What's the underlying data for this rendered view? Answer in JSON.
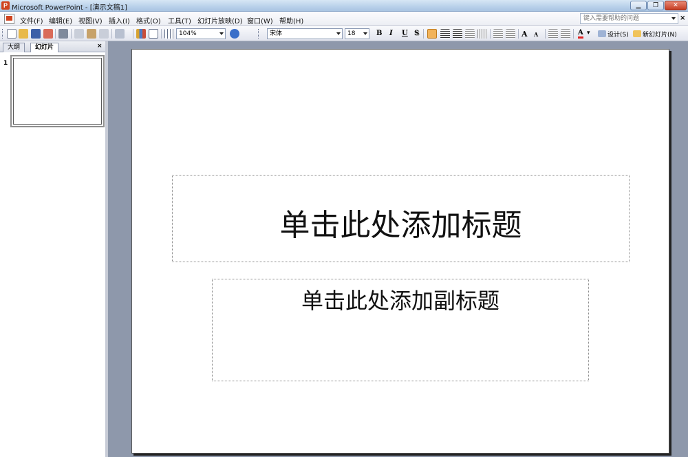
{
  "window": {
    "title": "Microsoft PowerPoint - [演示文稿1]",
    "app_icon_letter": "P"
  },
  "menu": {
    "items": [
      "文件(F)",
      "编辑(E)",
      "视图(V)",
      "插入(I)",
      "格式(O)",
      "工具(T)",
      "幻灯片放映(D)",
      "窗口(W)",
      "帮助(H)"
    ],
    "help_placeholder": "键入需要帮助的问题",
    "close_symbol": "×"
  },
  "toolbar": {
    "zoom": "104%",
    "font_name": "宋体",
    "font_size": "18",
    "bold": "B",
    "italic": "I",
    "underline": "U",
    "shadow": "S",
    "grow_font": "A",
    "shrink_font": "A",
    "font_color": "A",
    "design_label": "设计(S)",
    "new_slide_label": "新幻灯片(N)"
  },
  "left_pane": {
    "tabs": [
      "大纲",
      "幻灯片"
    ],
    "active_tab": "幻灯片",
    "close_symbol": "×",
    "slide_numbers": [
      "1"
    ]
  },
  "slide": {
    "title_placeholder": "单击此处添加标题",
    "subtitle_placeholder": "单击此处添加副标题"
  },
  "colors": {
    "accent": "#d0431f",
    "workspace": "#8e98ab"
  }
}
